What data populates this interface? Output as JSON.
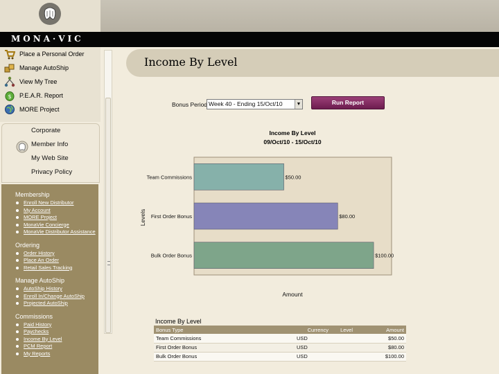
{
  "brand": {
    "name": "MONA·VIC"
  },
  "sidebar": {
    "menu": [
      {
        "label": "Place a Personal Order",
        "icon": "cart-icon"
      },
      {
        "label": "Manage AutoShip",
        "icon": "boxes-icon"
      },
      {
        "label": "View My Tree",
        "icon": "tree-icon"
      },
      {
        "label": "P.E.A.R. Report",
        "icon": "report-icon"
      },
      {
        "label": "MORE Project",
        "icon": "globe-icon"
      }
    ],
    "info": [
      {
        "label": "Corporate"
      },
      {
        "label": "Member Info"
      },
      {
        "label": "My Web Site"
      },
      {
        "label": "Privacy Policy"
      }
    ],
    "sections": [
      {
        "title": "Membership",
        "links": [
          "Enroll New Distributor",
          "My Account",
          "MORE Project",
          "MonaVie Concierge",
          "MonaVie Distributor Assistance"
        ]
      },
      {
        "title": "Ordering",
        "links": [
          "Order History",
          "Place An Order",
          "Retail Sales Tracking"
        ]
      },
      {
        "title": "Manage AutoShip",
        "links": [
          "AutoShip History",
          "Enroll In/Change AutoShip",
          "Projected AutoShip"
        ]
      },
      {
        "title": "Commissions",
        "links": [
          "Paid History",
          "Paychecks",
          "Income By Level",
          "PCM Report",
          "My Reports"
        ]
      }
    ]
  },
  "page": {
    "title": "Income By Level"
  },
  "controls": {
    "bonus_period_label": "Bonus Period:",
    "bonus_period_value": "Week 40 - Ending 15/Oct/10",
    "run_report_label": "Run Report"
  },
  "chart_data": {
    "type": "bar",
    "orientation": "horizontal",
    "title": "Income By Level",
    "subtitle": "09/Oct/10 - 15/Oct/10",
    "xlabel": "Amount",
    "ylabel": "Levels",
    "categories": [
      "Team Commissions",
      "First Order Bonus",
      "Bulk Order Bonus"
    ],
    "values": [
      50,
      80,
      100
    ],
    "value_labels": [
      "$50.00",
      "$80.00",
      "$100.00"
    ],
    "colors": [
      "#86b1aa",
      "#8685b8",
      "#7ea58a"
    ],
    "xlim": [
      0,
      110
    ],
    "grid": false
  },
  "table": {
    "title": "Income By Level",
    "headers": [
      "Bonus Type",
      "Currency",
      "Level",
      "Amount"
    ],
    "rows": [
      [
        "Team Commissions",
        "USD",
        "",
        "$50.00"
      ],
      [
        "First Order Bonus",
        "USD",
        "",
        "$80.00"
      ],
      [
        "Bulk Order Bonus",
        "USD",
        "",
        "$100.00"
      ]
    ]
  }
}
